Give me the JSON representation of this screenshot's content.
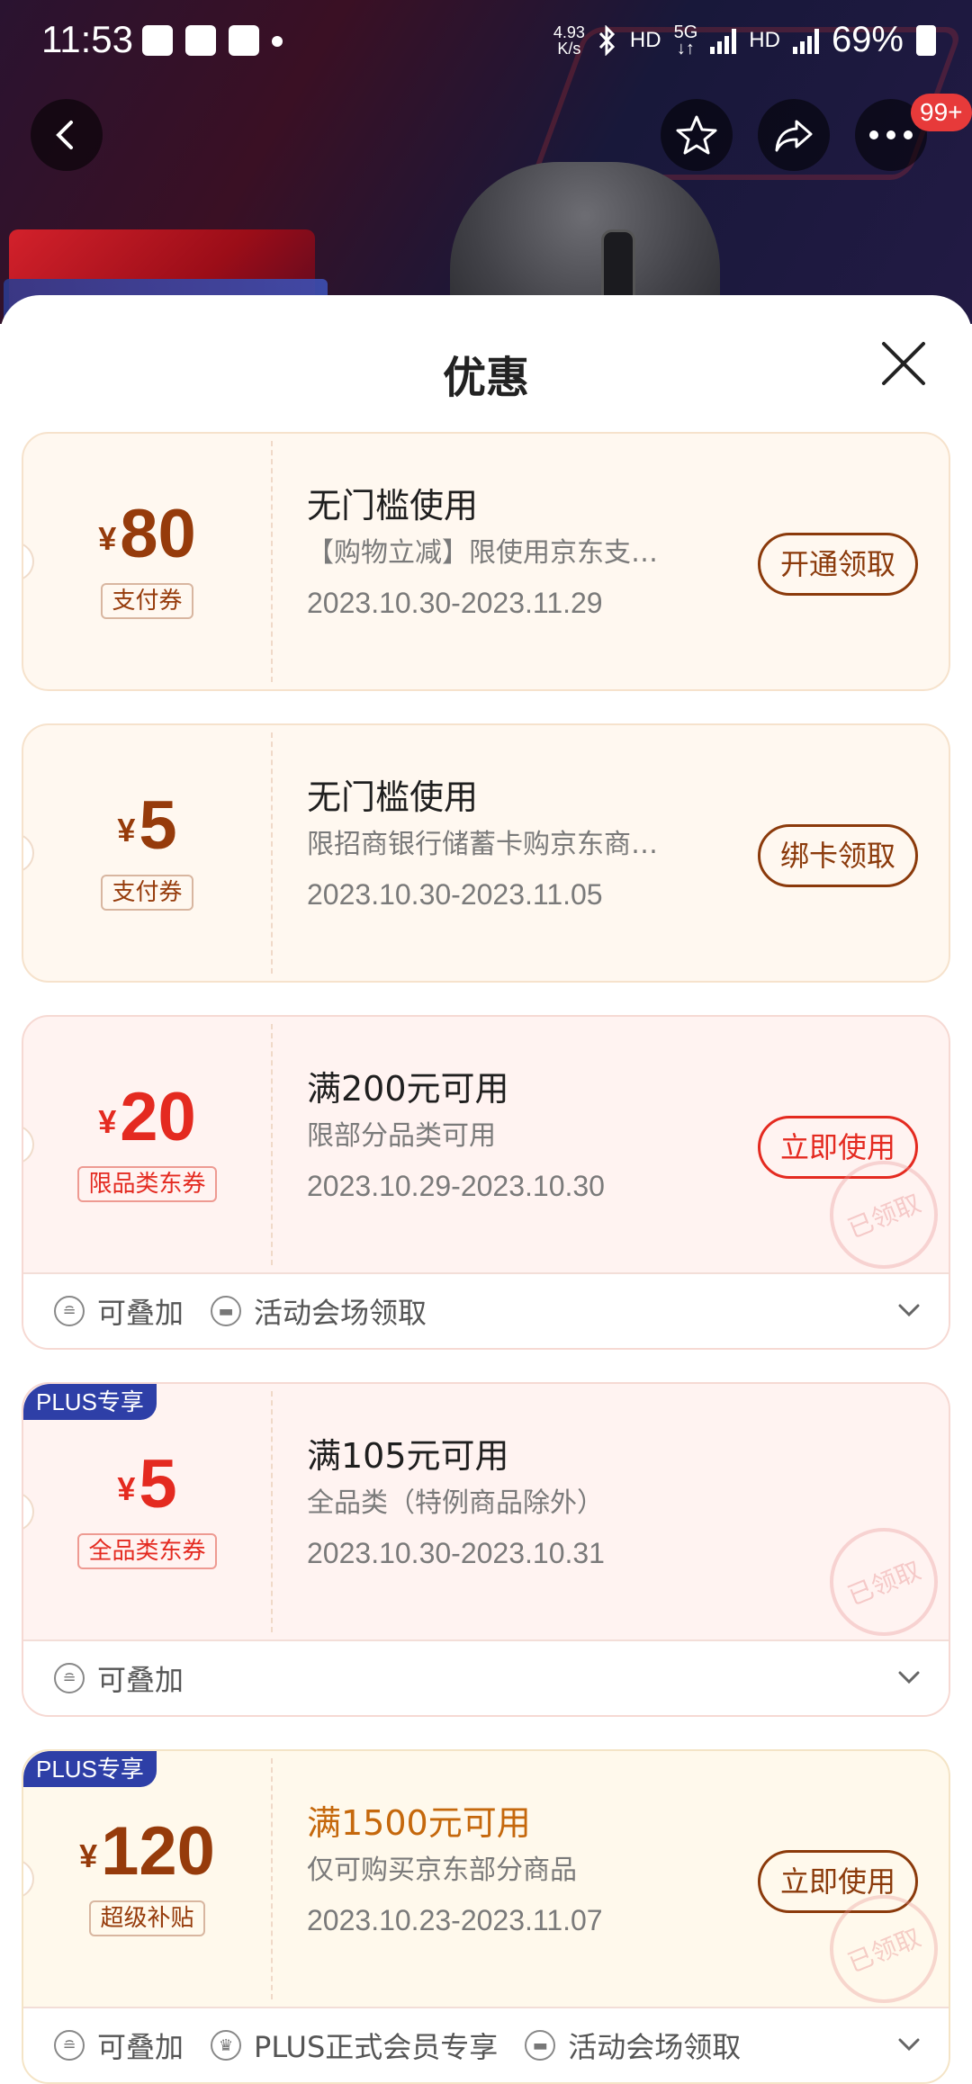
{
  "status_bar": {
    "time": "11:53",
    "net_speed": "4.93\nK/s",
    "battery": "69%"
  },
  "nav": {
    "badge": "99+"
  },
  "sheet": {
    "title": "优惠"
  },
  "coupons": [
    {
      "currency": "¥",
      "amount": "80",
      "tag": "支付券",
      "condition": "无门槛使用",
      "description": "【购物立减】限使用京东支…",
      "date": "2023.10.30-2023.11.29",
      "button": "开通领取"
    },
    {
      "currency": "¥",
      "amount": "5",
      "tag": "支付券",
      "condition": "无门槛使用",
      "description": "限招商银行储蓄卡购京东商…",
      "date": "2023.10.30-2023.11.05",
      "button": "绑卡领取"
    },
    {
      "currency": "¥",
      "amount": "20",
      "tag": "限品类东券",
      "condition": "满200元可用",
      "description": "限部分品类可用",
      "date": "2023.10.29-2023.10.30",
      "button": "立即使用",
      "stamp": "已领取",
      "features": [
        "可叠加",
        "活动会场领取"
      ]
    },
    {
      "plus": "PLUS专享",
      "currency": "¥",
      "amount": "5",
      "tag": "全品类东券",
      "condition": "满105元可用",
      "description": "全品类（特例商品除外）",
      "date": "2023.10.30-2023.10.31",
      "stamp": "已领取",
      "features": [
        "可叠加"
      ]
    },
    {
      "plus": "PLUS专享",
      "currency": "¥",
      "amount": "120",
      "tag": "超级补贴",
      "condition": "满1500元可用",
      "description": "仅可购买京东部分商品",
      "date": "2023.10.23-2023.11.07",
      "button": "立即使用",
      "stamp": "已领取",
      "features": [
        "可叠加",
        "PLUS正式会员专享",
        "活动会场领取"
      ]
    }
  ],
  "colors": {
    "brown": "#963b0b",
    "red": "#e42a20",
    "gold_text": "#c5680c",
    "plus_badge": "#2e3fa7"
  }
}
